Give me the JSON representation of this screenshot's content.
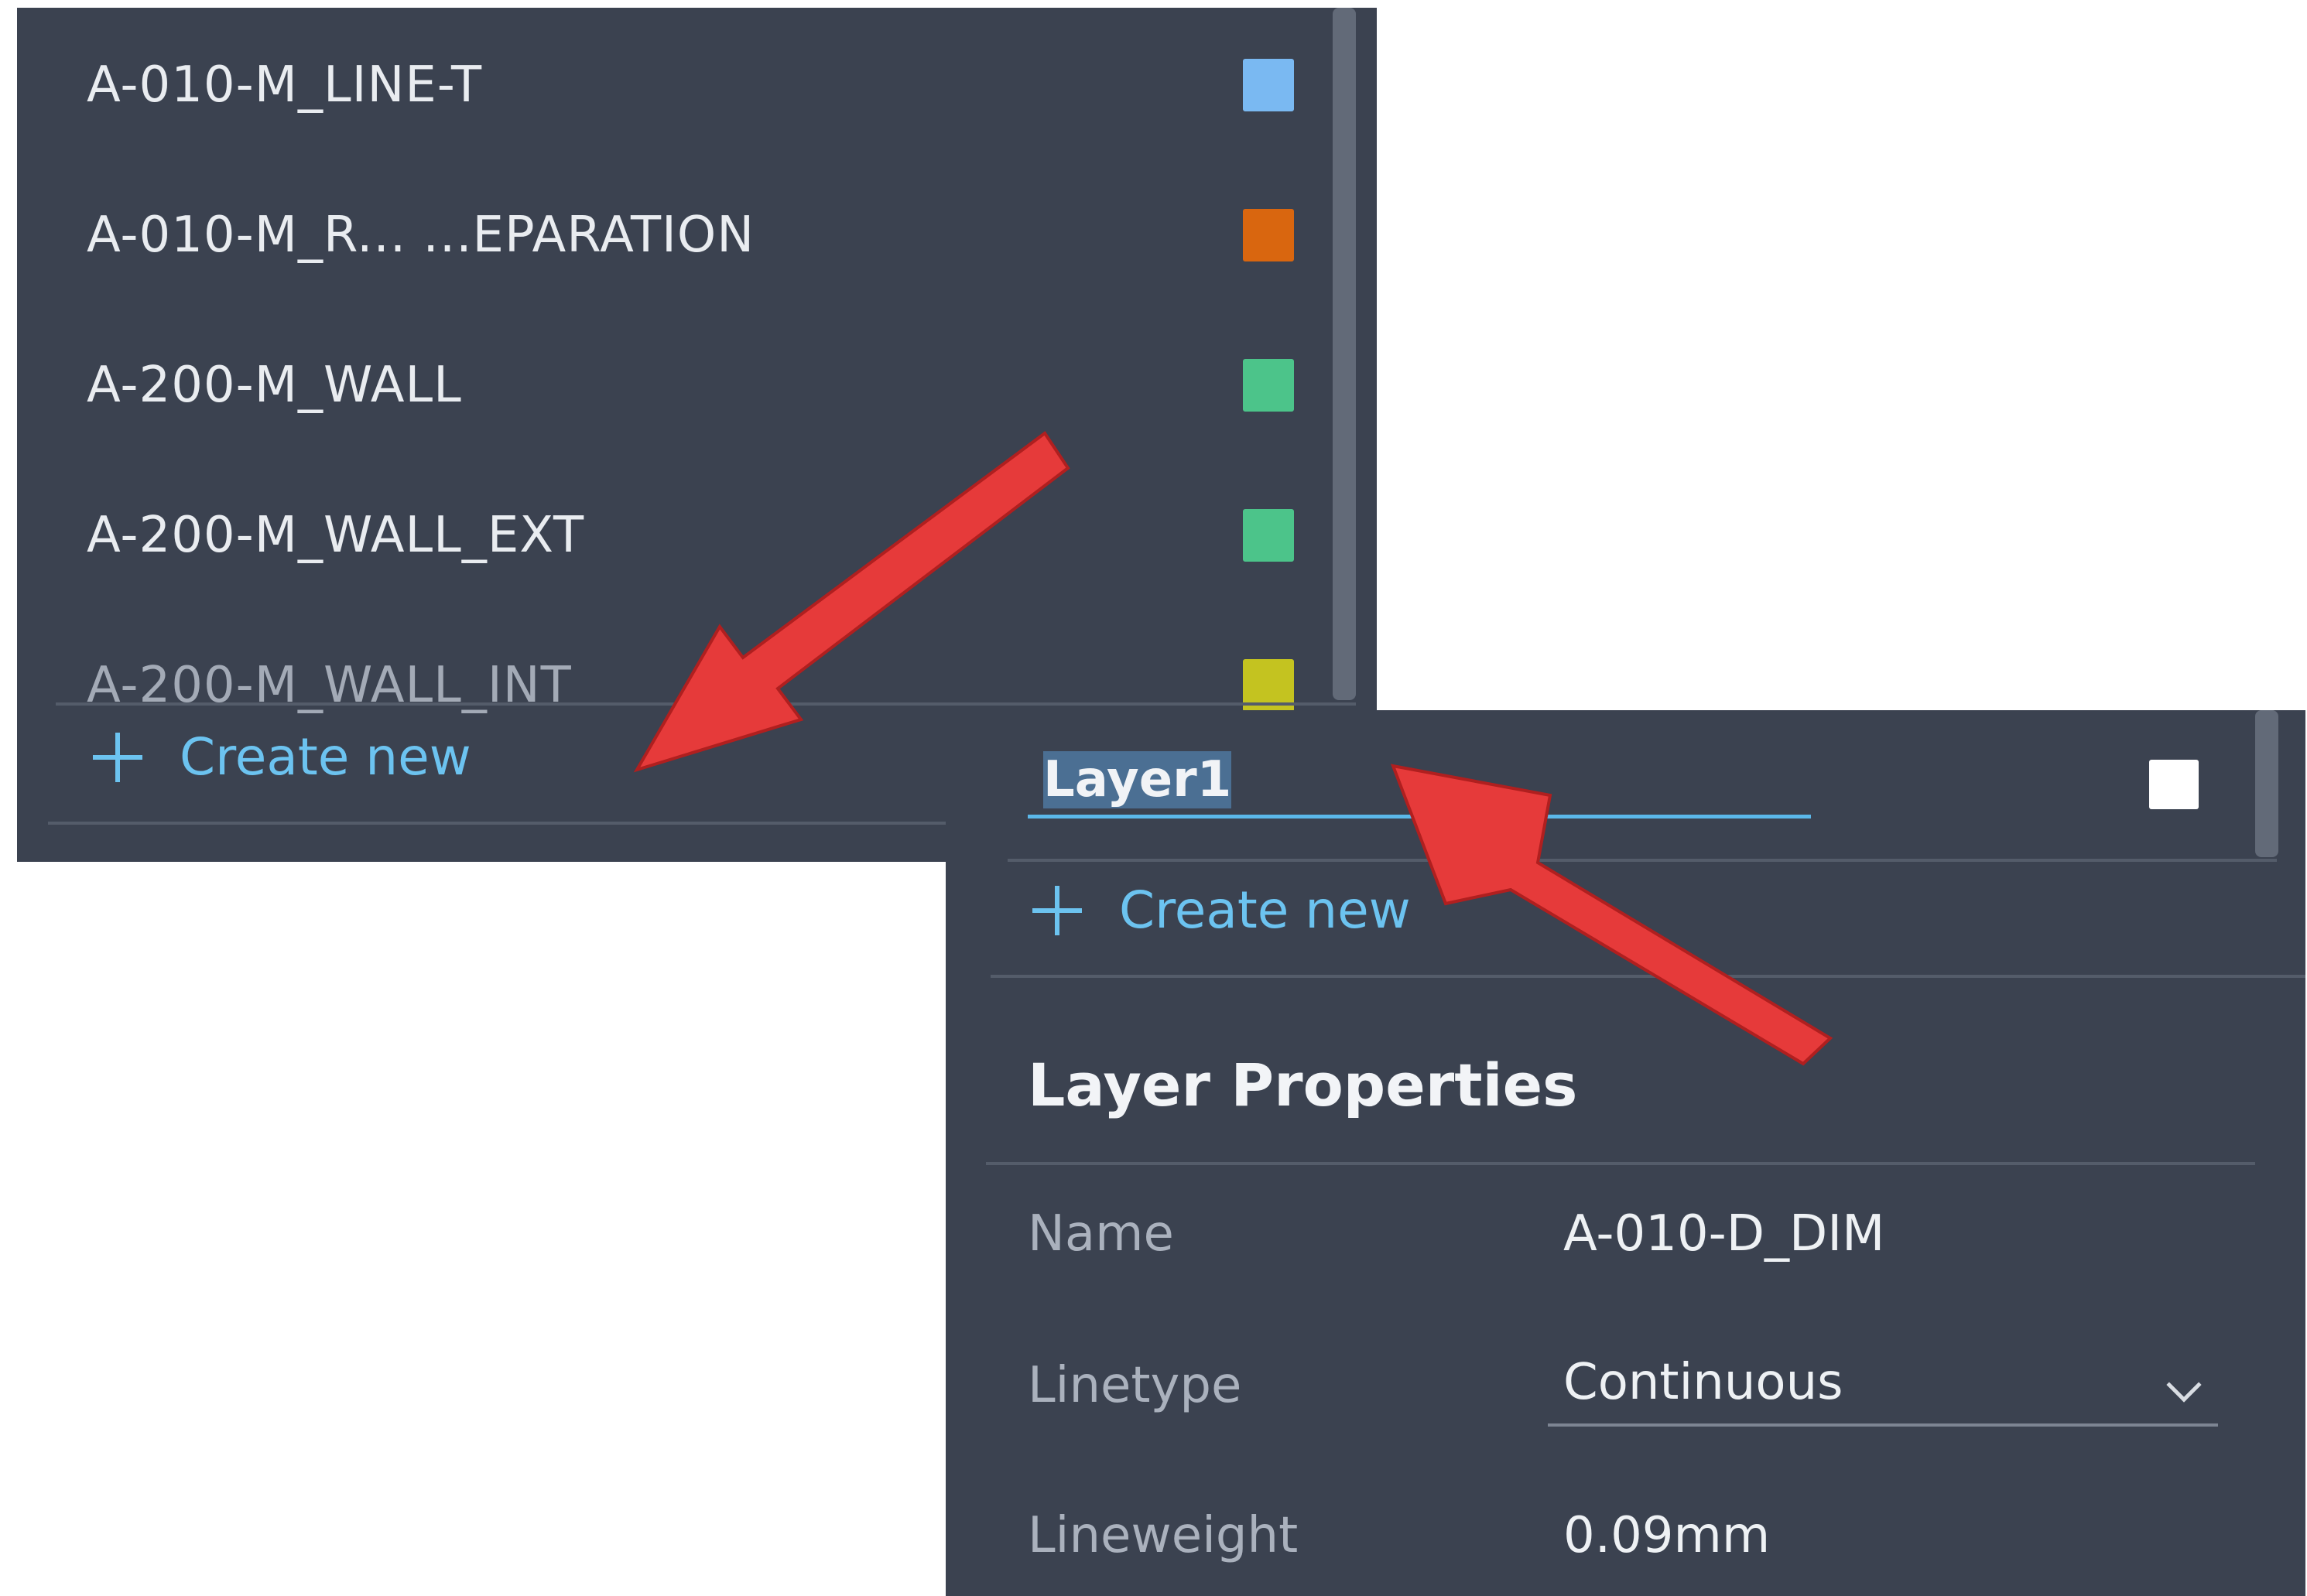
{
  "colors": {
    "panel_bg": "#3b4250",
    "accent": "#6cc3f0",
    "annotation_arrow": "#e63a3a"
  },
  "layer_list": {
    "items": [
      {
        "name": "A-010-M_LINE-T",
        "color": "#7ab9f2"
      },
      {
        "name": "A-010-M_R...   ...EPARATION",
        "color": "#d9660f"
      },
      {
        "name": "A-200-M_WALL",
        "color": "#4cc48a"
      },
      {
        "name": "A-200-M_WALL_EXT",
        "color": "#4cc48a"
      },
      {
        "name": "A-200-M_WALL_INT",
        "color": "#c4c320"
      }
    ],
    "create_new_label": "Create new"
  },
  "new_layer_panel": {
    "name_input_value": "Layer1",
    "swatch_color": "#ffffff",
    "create_new_label": "Create new",
    "properties": {
      "title": "Layer Properties",
      "name_label": "Name",
      "name_value": "A-010-D_DIM",
      "linetype_label": "Linetype",
      "linetype_value": "Continuous",
      "lineweight_label": "Lineweight",
      "lineweight_value": "0.09mm"
    }
  }
}
